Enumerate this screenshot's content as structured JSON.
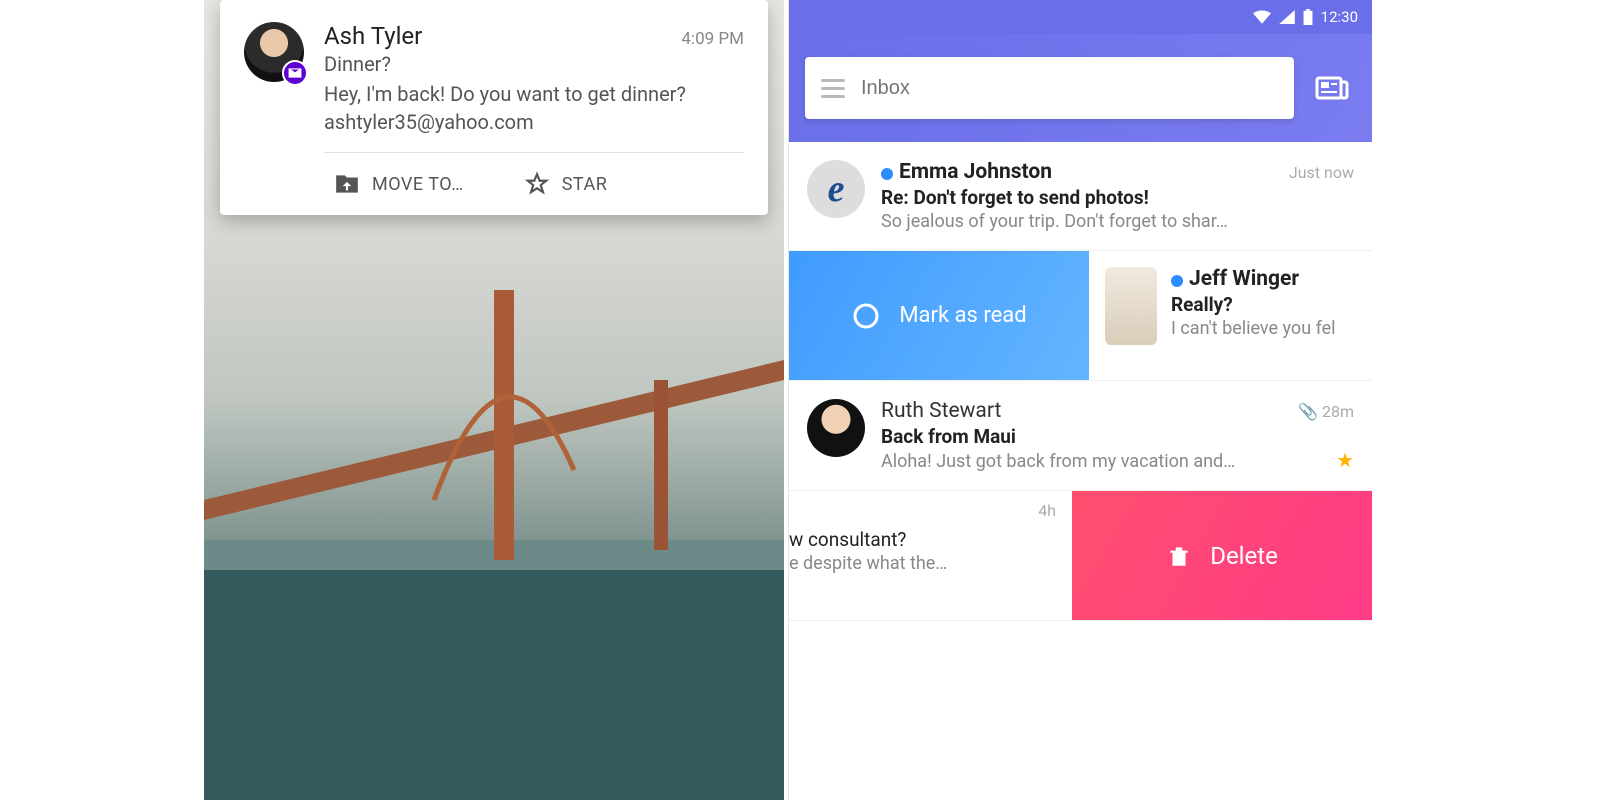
{
  "left": {
    "notification": {
      "sender": "Ash Tyler",
      "time": "4:09 PM",
      "subject": "Dinner?",
      "preview": "Hey, I'm back!  Do you want to get dinner?",
      "email": "ashtyler35@yahoo.com",
      "actions": {
        "move": "MOVE TO…",
        "star": "STAR"
      }
    }
  },
  "right": {
    "status_time": "12:30",
    "search_placeholder": "Inbox",
    "swipe_read_label": "Mark as read",
    "swipe_delete_label": "Delete",
    "emails": [
      {
        "sender": "Emma Johnston",
        "time": "Just now",
        "subject": "Re: Don't forget to send photos!",
        "preview": "So jealous of your trip. Don't forget to shar…",
        "unread": true,
        "avatar_letter": "e"
      },
      {
        "sender": "Jeff Winger",
        "subject": "Really?",
        "preview": "I can't believe you fel",
        "unread": true
      },
      {
        "sender": "Ruth Stewart",
        "time": "28m",
        "subject": "Back from Maui",
        "preview": "Aloha! Just got back from my vacation and…",
        "unread": false,
        "has_attachment": true,
        "starred": true
      },
      {
        "time": "4h",
        "subject": "w consultant?",
        "preview": "e despite what the…"
      }
    ]
  }
}
